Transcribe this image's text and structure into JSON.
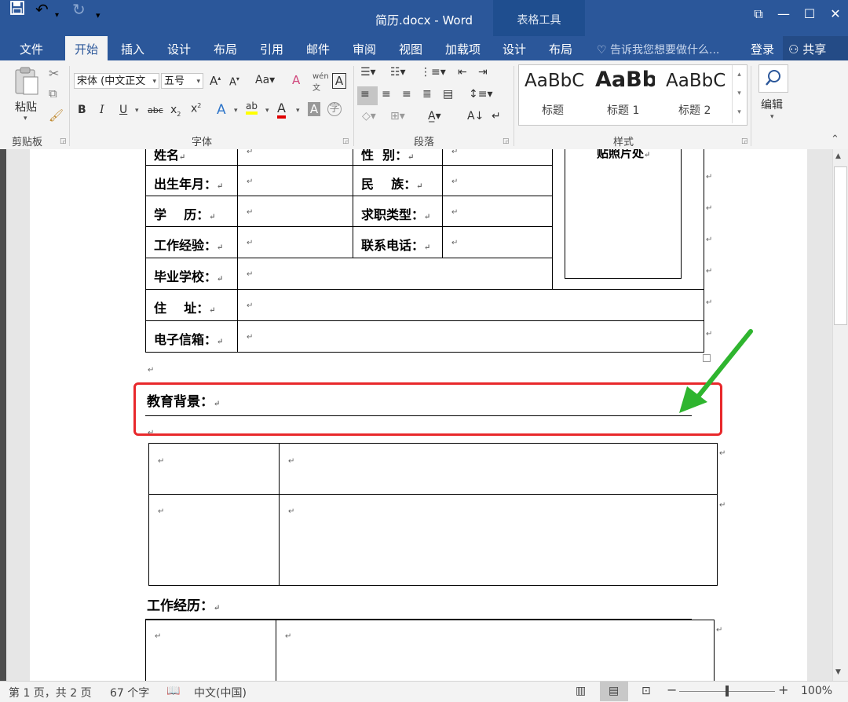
{
  "window": {
    "title": "简历.docx - Word",
    "context_tab_group": "表格工具",
    "controls": {
      "restore": "⧉",
      "minimize": "—",
      "maximize": "☐",
      "close": "✕"
    }
  },
  "quick_access": {
    "save": "💾",
    "undo": "↶",
    "redo": "↻",
    "customize": "▾"
  },
  "tabs": [
    "文件",
    "开始",
    "插入",
    "设计",
    "布局",
    "引用",
    "邮件",
    "审阅",
    "视图",
    "加载项",
    "设计",
    "布局"
  ],
  "tell_me": "告诉我您想要做什么...",
  "login": "登录",
  "share": "共享",
  "ribbon": {
    "clipboard": {
      "paste": "粘贴",
      "label": "剪贴板"
    },
    "font": {
      "font_name": "宋体 (中文正文",
      "font_size": "五号",
      "label": "字体"
    },
    "paragraph": {
      "label": "段落"
    },
    "styles": {
      "label": "样式",
      "items": [
        {
          "sample": "AaBbC",
          "name": "标题"
        },
        {
          "sample": "AaBb",
          "name": "标题 1"
        },
        {
          "sample": "AaBbC",
          "name": "标题 2"
        }
      ]
    },
    "editing": {
      "label": "编辑"
    }
  },
  "document": {
    "top_table": {
      "partial_row": {
        "label": "姓名",
        "label2": "性  别：",
        "photo": "贴照片处"
      },
      "rows": [
        {
          "label": "出生年月：",
          "label2": "民    族："
        },
        {
          "label": "学    历：",
          "label2": "求职类型："
        },
        {
          "label": "工作经验：",
          "label2": "联系电话："
        }
      ],
      "wide_rows": [
        {
          "label": "毕业学校："
        },
        {
          "label": "住    址："
        },
        {
          "label": "电子信箱："
        }
      ]
    },
    "section_education": "教育背景：",
    "section_work": "工作经历：",
    "paragraph_mark": "↵"
  },
  "status": {
    "page": "第 1 页，共 2 页",
    "words": "67 个字",
    "language": "中文(中国)",
    "zoom": "100%",
    "zoom_level": 100
  },
  "annotation": {
    "highlight_color": "#e8282b",
    "arrow_color": "#2fb52f"
  }
}
